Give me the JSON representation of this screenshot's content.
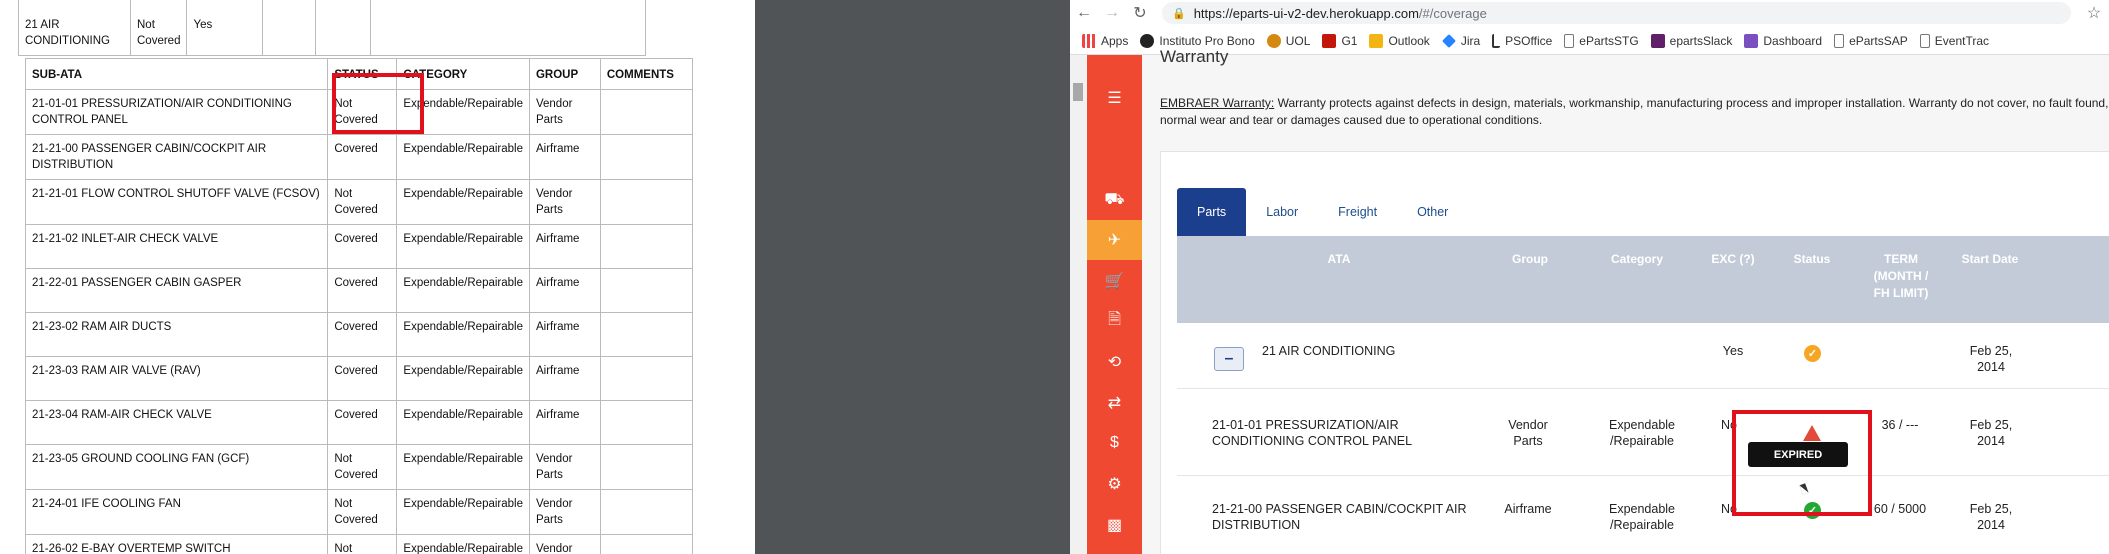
{
  "document": {
    "top_row": {
      "name": "21 AIR CONDITIONING",
      "status": "Not Covered",
      "exc": "Yes"
    },
    "headers": [
      "SUB-ATA",
      "STATUS",
      "CATEGORY",
      "GROUP",
      "COMMENTS"
    ],
    "rows": [
      {
        "ata": "21-01-01 PRESSURIZATION/AIR CONDITIONING CONTROL PANEL",
        "status": "Not Covered",
        "category": "Expendable/Repairable",
        "group": "Vendor Parts"
      },
      {
        "ata": "21-21-00 PASSENGER CABIN/COCKPIT AIR DISTRIBUTION",
        "status": "Covered",
        "category": "Expendable/Repairable",
        "group": "Airframe"
      },
      {
        "ata": "21-21-01 FLOW CONTROL SHUTOFF VALVE (FCSOV)",
        "status": "Not Covered",
        "category": "Expendable/Repairable",
        "group": "Vendor Parts"
      },
      {
        "ata": "21-21-02 INLET-AIR CHECK VALVE",
        "status": "Covered",
        "category": "Expendable/Repairable",
        "group": "Airframe"
      },
      {
        "ata": "21-22-01 PASSENGER CABIN GASPER",
        "status": "Covered",
        "category": "Expendable/Repairable",
        "group": "Airframe"
      },
      {
        "ata": "21-23-02 RAM AIR DUCTS",
        "status": "Covered",
        "category": "Expendable/Repairable",
        "group": "Airframe"
      },
      {
        "ata": "21-23-03 RAM AIR VALVE (RAV)",
        "status": "Covered",
        "category": "Expendable/Repairable",
        "group": "Airframe"
      },
      {
        "ata": "21-23-04 RAM-AIR CHECK VALVE",
        "status": "Covered",
        "category": "Expendable/Repairable",
        "group": "Airframe"
      },
      {
        "ata": "21-23-05 GROUND COOLING FAN (GCF)",
        "status": "Not Covered",
        "category": "Expendable/Repairable",
        "group": "Vendor Parts"
      },
      {
        "ata": "21-24-01 IFE COOLING FAN",
        "status": "Not Covered",
        "category": "Expendable/Repairable",
        "group": "Vendor Parts"
      },
      {
        "ata": "21-26-02 E-BAY OVERTEMP SWITCH",
        "status": "Not",
        "category": "Expendable/Repairable",
        "group": "Vendor"
      }
    ]
  },
  "browser": {
    "url_host": "https://eparts-ui-v2-dev.herokuapp.com",
    "url_path": "/#/coverage",
    "bookmarks": [
      "Apps",
      "Instituto Pro Bono",
      "UOL",
      "G1",
      "Outlook",
      "Jira",
      "PSOffice",
      "ePartsSTG",
      "epartsSlack",
      "Dashboard",
      "ePartsSAP",
      "EventTrac"
    ]
  },
  "app": {
    "page_title": "Warranty",
    "warranty_label": "EMBRAER Warranty:",
    "warranty_text": " Warranty protects against defects in design, materials, workmanship, manufacturing process and improper installation. Warranty do not cover, no fault found, normal wear and tear or damages caused due to operational conditions.",
    "tabs": [
      "Parts",
      "Labor",
      "Freight",
      "Other"
    ],
    "active_tab": "Parts",
    "columns": {
      "ata": "ATA",
      "group": "Group",
      "category": "Category",
      "exc": "EXC (?)",
      "status": "Status",
      "term": "TERM (MONTH / FH LIMIT)",
      "start": "Start Date"
    },
    "rows": [
      {
        "ata": "21 AIR CONDITIONING",
        "group": "",
        "category": "",
        "exc": "Yes",
        "status": "partial",
        "term": "",
        "start": "Feb 25, 2014"
      },
      {
        "ata": "21-01-01 PRESSURIZATION/AIR CONDITIONING CONTROL PANEL",
        "group": "Vendor Parts",
        "category": "Expendable /Repairable",
        "exc": "No",
        "status": "expired",
        "term": "36 / ---",
        "start": "Feb 25, 2014"
      },
      {
        "ata": "21-21-00 PASSENGER CABIN/COCKPIT AIR DISTRIBUTION",
        "group": "Airframe",
        "category": "Expendable /Repairable",
        "exc": "No",
        "status": "active",
        "term": "60 / 5000",
        "start": "Feb 25, 2014"
      }
    ],
    "tooltip": "EXPIRED",
    "colors": {
      "sidebar": "#ef4a31",
      "sidebar_active": "#f7a035",
      "tab_active": "#1b3f8c",
      "grid_head": "#c3cbd8",
      "highlight": "#e0111d",
      "ok": "#22a833",
      "warn": "#f5a623",
      "expired": "#e24b3a"
    }
  }
}
